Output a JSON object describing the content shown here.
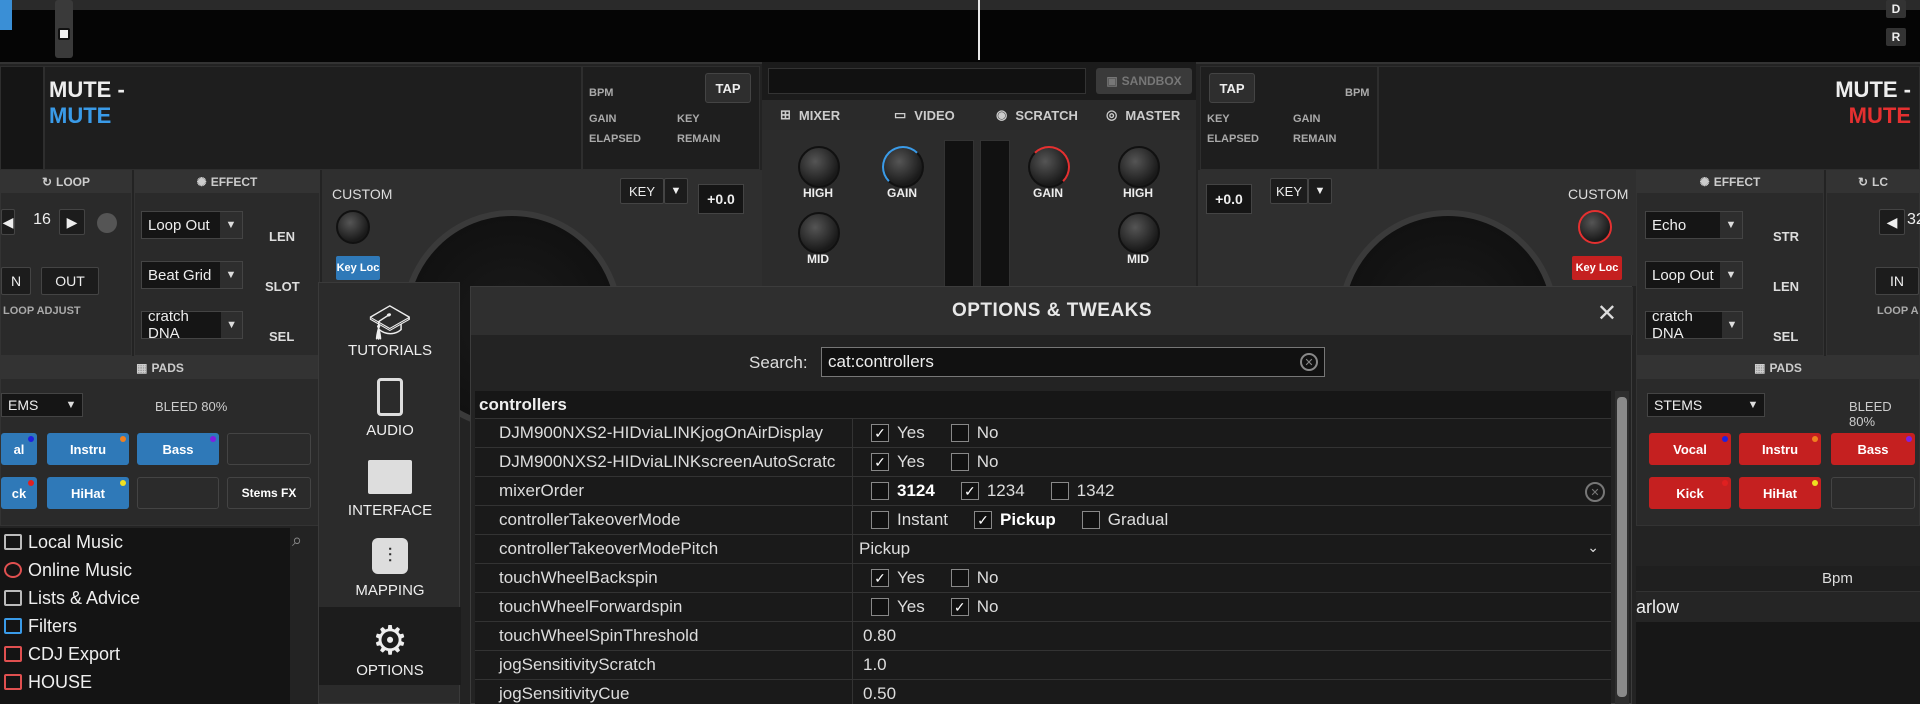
{
  "top": {
    "d_label": "D",
    "r_label": "R"
  },
  "deck_left": {
    "title": "MUTE -",
    "subtitle": "MUTE",
    "subtitle_color": "#3a9be8",
    "bpm_label": "BPM",
    "gain_label": "GAIN",
    "key_label": "KEY",
    "elapsed_label": "ELAPSED",
    "remain_label": "REMAIN",
    "tap_label": "TAP",
    "loop_header": "LOOP",
    "loop_value": "16",
    "in_label": "N",
    "out_label": "OUT",
    "loop_adjust": "LOOP ADJUST",
    "effect_header": "EFFECT",
    "effect_dd": [
      "Loop Out",
      "Beat Grid",
      "cratch DNA"
    ],
    "effect_sliders": [
      "LEN",
      "SLOT",
      "SEL"
    ],
    "custom_label": "CUSTOM",
    "keyloc_label": "Key Loc",
    "key_btn": "KEY",
    "pitch_label": "+0.0",
    "pads_header": "PADS",
    "stems_label": "EMS",
    "bleed_label": "BLEED 80%",
    "pads": [
      "al",
      "Instru",
      "Bass",
      "",
      "ck",
      "HiHat",
      "",
      "Stems FX"
    ]
  },
  "deck_right": {
    "title": "MUTE -",
    "subtitle": "MUTE",
    "subtitle_color": "#e53030",
    "bpm_label": "BPM",
    "gain_label": "GAIN",
    "key_label": "KEY",
    "elapsed_label": "ELAPSED",
    "remain_label": "REMAIN",
    "tap_label": "TAP",
    "effect_header": "EFFECT",
    "effect_dd": [
      "Echo",
      "Loop Out",
      "cratch DNA"
    ],
    "effect_sliders": [
      "STR",
      "LEN",
      "SEL"
    ],
    "loop_header": "LC",
    "loop_value": "32",
    "in_label": "IN",
    "loop_adjust": "LOOP A",
    "custom_label": "CUSTOM",
    "keyloc_label": "Key Loc",
    "key_btn": "KEY",
    "pitch_label": "+0.0",
    "pads_header": "PADS",
    "stems_label": "STEMS",
    "bleed_label": "BLEED 80%",
    "pads": [
      "Vocal",
      "Instru",
      "Bass",
      "Kick",
      "HiHat",
      ""
    ]
  },
  "mixer": {
    "sandbox_label": "SANDBOX",
    "tabs": [
      "MIXER",
      "VIDEO",
      "SCRATCH",
      "MASTER"
    ],
    "knobs": [
      "HIGH",
      "GAIN",
      "GAIN",
      "HIGH",
      "MID",
      "MID"
    ]
  },
  "browser": {
    "items": [
      "Local Music",
      "Online Music",
      "Lists & Advice",
      "Filters",
      "CDJ Export",
      "HOUSE"
    ]
  },
  "sidebar": {
    "items": [
      "TUTORIALS",
      "AUDIO",
      "INTERFACE",
      "MAPPING",
      "OPTIONS"
    ],
    "active": "OPTIONS"
  },
  "dialog": {
    "title": "OPTIONS & TWEAKS",
    "search_label": "Search:",
    "search_value": "cat:controllers",
    "category": "controllers",
    "rows": [
      {
        "name": "DJM900NXS2-HIDviaLINKjogOnAirDisplay",
        "type": "choice",
        "options": [
          {
            "label": "Yes",
            "checked": true
          },
          {
            "label": "No",
            "checked": false
          }
        ]
      },
      {
        "name": "DJM900NXS2-HIDviaLINKscreenAutoScratc",
        "type": "choice",
        "options": [
          {
            "label": "Yes",
            "checked": true
          },
          {
            "label": "No",
            "checked": false
          }
        ]
      },
      {
        "name": "mixerOrder",
        "type": "choice",
        "clear": true,
        "options": [
          {
            "label": "3124",
            "checked": false,
            "bold": true
          },
          {
            "label": "1234",
            "checked": true
          },
          {
            "label": "1342",
            "checked": false
          }
        ]
      },
      {
        "name": "controllerTakeoverMode",
        "type": "choice",
        "options": [
          {
            "label": "Instant",
            "checked": false
          },
          {
            "label": "Pickup",
            "checked": true,
            "bold": true
          },
          {
            "label": "Gradual",
            "checked": false
          }
        ]
      },
      {
        "name": "controllerTakeoverModePitch",
        "type": "select",
        "value": "Pickup"
      },
      {
        "name": "touchWheelBackspin",
        "type": "choice",
        "options": [
          {
            "label": "Yes",
            "checked": true
          },
          {
            "label": "No",
            "checked": false
          }
        ]
      },
      {
        "name": "touchWheelForwardspin",
        "type": "choice",
        "options": [
          {
            "label": "Yes",
            "checked": false
          },
          {
            "label": "No",
            "checked": true
          }
        ]
      },
      {
        "name": "touchWheelSpinThreshold",
        "type": "text",
        "value": "0.80"
      },
      {
        "name": "jogSensitivityScratch",
        "type": "text",
        "value": "1.0"
      },
      {
        "name": "jogSensitivityCue",
        "type": "text",
        "value": "0.50"
      }
    ]
  },
  "right_browser": {
    "col_header": "Bpm",
    "row_text": "arlow"
  }
}
